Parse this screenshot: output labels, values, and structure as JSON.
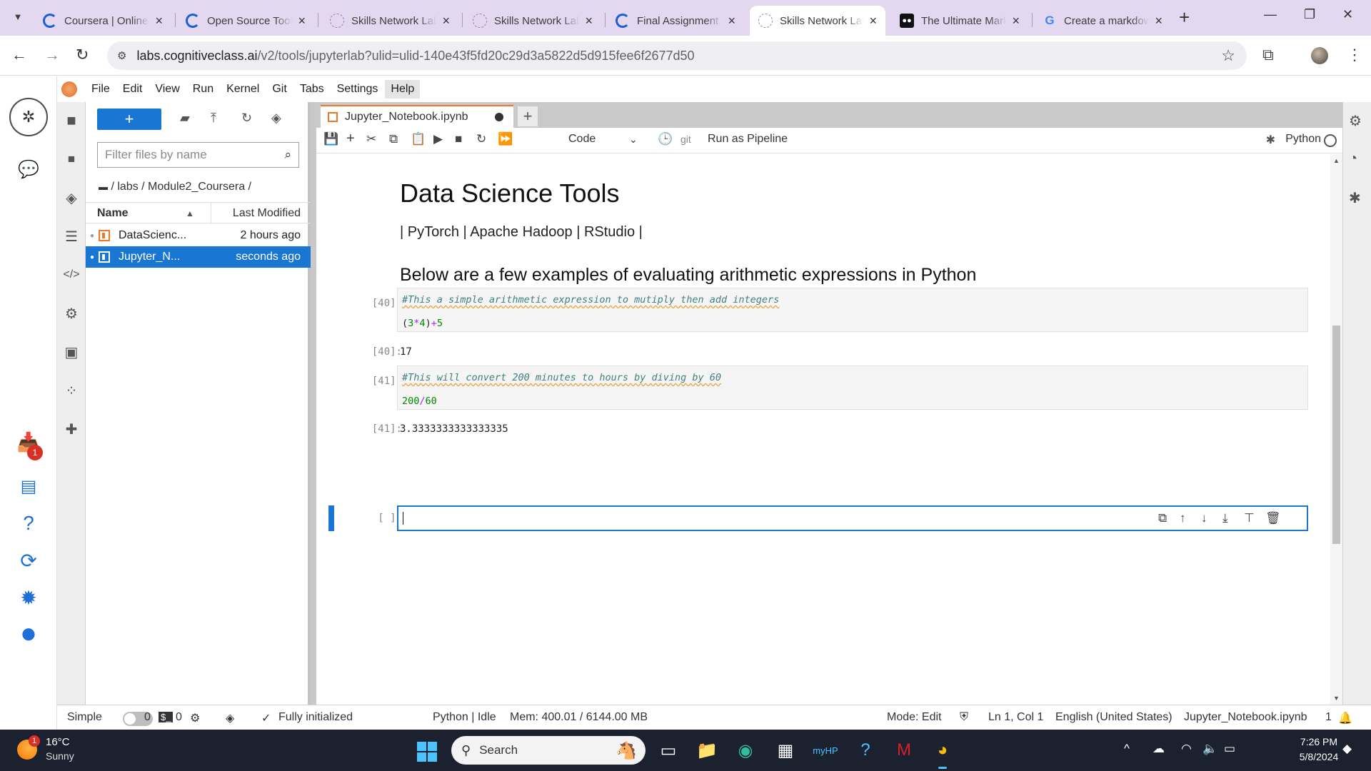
{
  "browser": {
    "tabs": [
      {
        "title": "Coursera | Online Courses",
        "icon": "coursera-icon"
      },
      {
        "title": "Open Source Tools",
        "icon": "coursera-icon"
      },
      {
        "title": "Skills Network Labs",
        "icon": "skills-network-icon"
      },
      {
        "title": "Skills Network Labs",
        "icon": "skills-network-icon"
      },
      {
        "title": "Final Assignment",
        "icon": "coursera-icon"
      },
      {
        "title": "Skills Network Labs",
        "icon": "skills-network-icon",
        "active": true
      },
      {
        "title": "The Ultimate Markdown",
        "icon": "medium-icon"
      },
      {
        "title": "Create a markdown",
        "icon": "google-icon"
      }
    ],
    "url_host": "labs.cognitiveclass.ai",
    "url_path": "/v2/tools/jupyterlab?ulid=ulid-140e43f5fd20c29d3a5822d5d915fee6f2677d50"
  },
  "menubar": [
    "File",
    "Edit",
    "View",
    "Run",
    "Kernel",
    "Git",
    "Tabs",
    "Settings",
    "Help"
  ],
  "filebrowser": {
    "filter_placeholder": "Filter files by name",
    "breadcrumb": "/ labs / Module2_Coursera /",
    "col_name": "Name",
    "col_modified": "Last Modified",
    "files": [
      {
        "name": "DataScienc...",
        "modified": "2 hours ago",
        "selected": false
      },
      {
        "name": "Jupyter_N...",
        "modified": "seconds ago",
        "selected": true
      }
    ]
  },
  "notebook": {
    "tab_title": "Jupyter_Notebook.ipynb",
    "cell_type": "Code",
    "git_label": "git",
    "pipeline_label": "Run as Pipeline",
    "kernel": "Python",
    "heading": "Data Science Tools",
    "tools_line": "| PyTorch | Apache Hadoop | RStudio |",
    "subheading": "Below are a few examples of evaluating arithmetic expressions in Python",
    "cells": [
      {
        "in_prompt": "[40]:",
        "comment": "#This a simple arithmetic expression to mutiply then add integers",
        "code": "(3*4)+5",
        "out_prompt": "[40]:",
        "output": "17"
      },
      {
        "in_prompt": "[41]:",
        "comment": "#This will convert 200 minutes to hours by diving by 60",
        "code": "200/60",
        "out_prompt": "[41]:",
        "output": "3.3333333333333335"
      }
    ],
    "empty_prompt": "[ ]:"
  },
  "statusbar": {
    "mode_simple": "Simple",
    "terminals": "0",
    "kernels": "0",
    "init": "Fully initialized",
    "kernel_state": "Python | Idle",
    "mem": "Mem: 400.01 / 6144.00 MB",
    "mode": "Mode: Edit",
    "cursor": "Ln 1, Col 1",
    "language": "English (United States)",
    "filename": "Jupyter_Notebook.ipynb",
    "notifications": "1"
  },
  "sidebar": {
    "notification_badge": "1"
  },
  "taskbar": {
    "temp": "16°C",
    "condition": "Sunny",
    "weather_badge": "1",
    "search_label": "Search",
    "time": "7:26 PM",
    "date": "5/8/2024"
  },
  "colors": {
    "accent": "#1976d2",
    "notebook_orange": "#f37626",
    "tabstrip": "#e4d8f0"
  }
}
